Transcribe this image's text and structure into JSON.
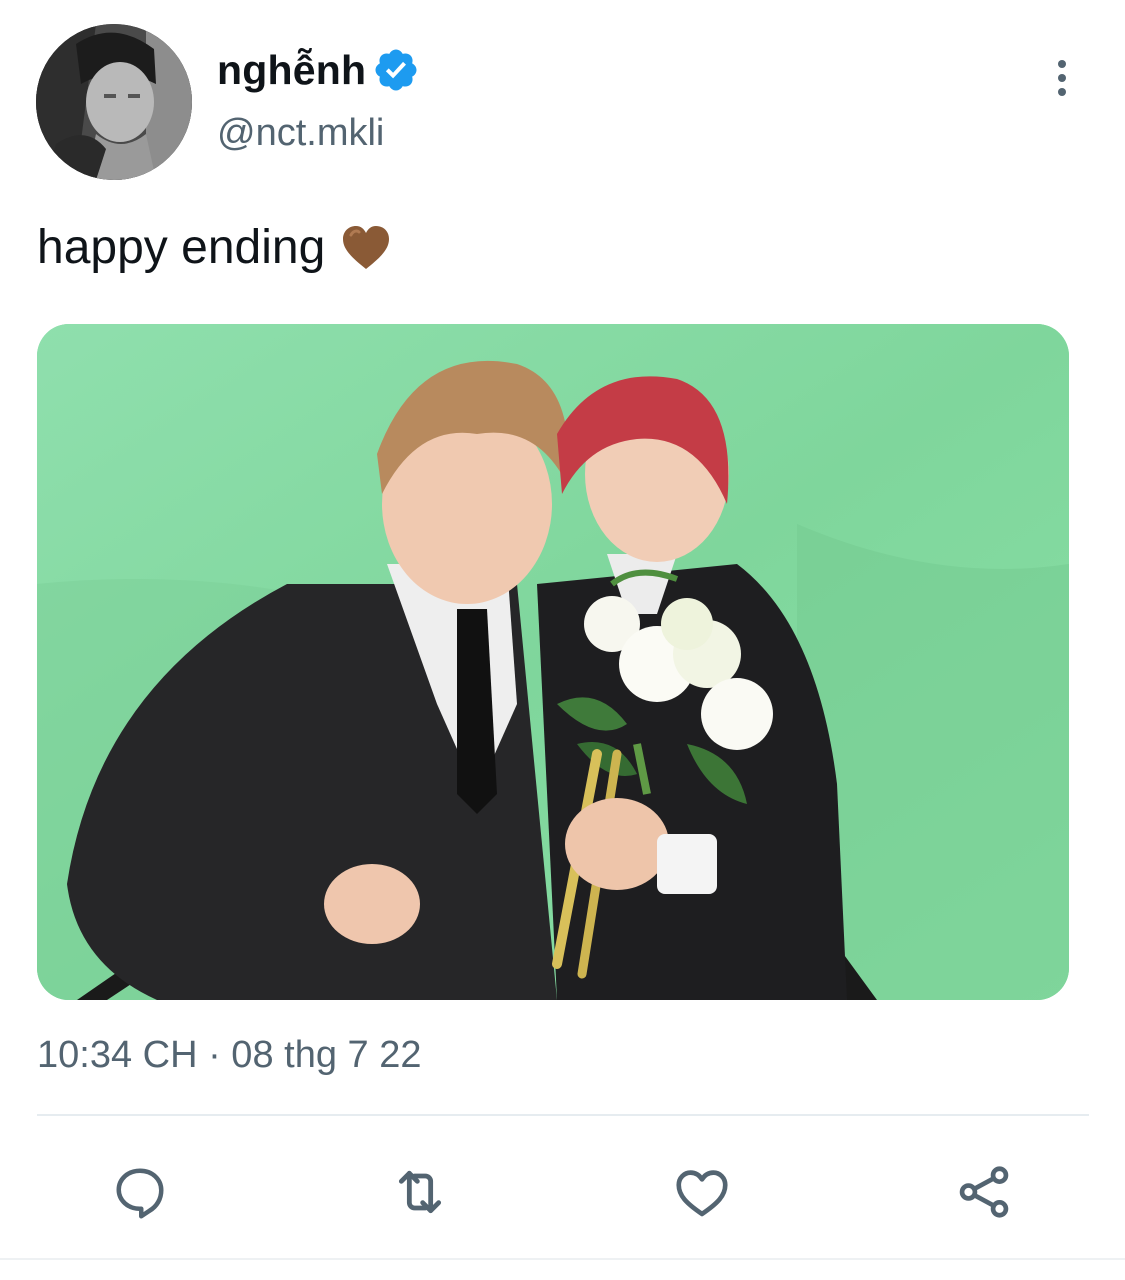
{
  "author": {
    "display_name": "nghễnh",
    "handle": "@nct.mkli",
    "verified": true,
    "verified_color": "#1d9bf0",
    "avatar_icon": "avatar-photo"
  },
  "tweet": {
    "text": "happy ending",
    "emoji": "brown-heart-icon",
    "emoji_color": "#8a5a36",
    "timestamp": "10:34 CH · 08 thg 7 22",
    "media_icon": "photo-two-people-green-screen"
  },
  "actions": [
    {
      "name": "reply-icon"
    },
    {
      "name": "retweet-icon"
    },
    {
      "name": "like-icon"
    },
    {
      "name": "share-icon"
    }
  ],
  "colors": {
    "text": "#0f1419",
    "secondary_text": "#536471",
    "divider": "#e6ecf0",
    "media_background": "#86dca4"
  }
}
